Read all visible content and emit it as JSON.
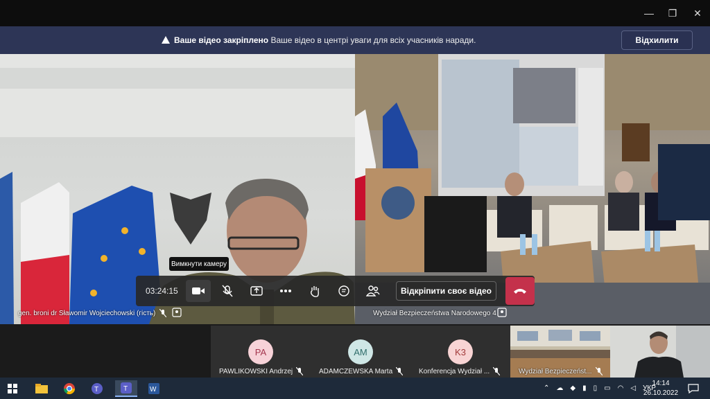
{
  "window": {
    "minimize": "—",
    "restore": "❐",
    "close": "✕"
  },
  "banner": {
    "title": "Ваше відео закріплено",
    "message": "Ваше відео в центрі уваги для всіх учасників наради.",
    "dismiss_label": "Відхилити"
  },
  "videos": {
    "left_name": "gen. broni dr Sławomir Wojciechowski (гість)",
    "right_name": "Wydział Bezpieczeństwa Narodowego 4"
  },
  "controls": {
    "timer": "03:24:15",
    "camera_tooltip": "Вимкнути камеру",
    "unpin_label": "Відкріпити своє відео"
  },
  "participants": [
    {
      "initials": "PA",
      "name": "PAWLIKOWSKI Andrzej",
      "color": "#f7d2d8",
      "text_color": "#a3354d"
    },
    {
      "initials": "AM",
      "name": "ADAMCZEWSKA Marta",
      "color": "#cfe7e6",
      "text_color": "#2f6d6b"
    },
    {
      "initials": "K3",
      "name": "Konferencja Wydział ...",
      "color": "#f8d4d4",
      "text_color": "#a23a3a"
    }
  ],
  "thumbnails": {
    "room_name": "Wydział Bezpieczeńst..."
  },
  "taskbar": {
    "language": "УКР",
    "time": "14:14",
    "date": "26.10.2022"
  }
}
